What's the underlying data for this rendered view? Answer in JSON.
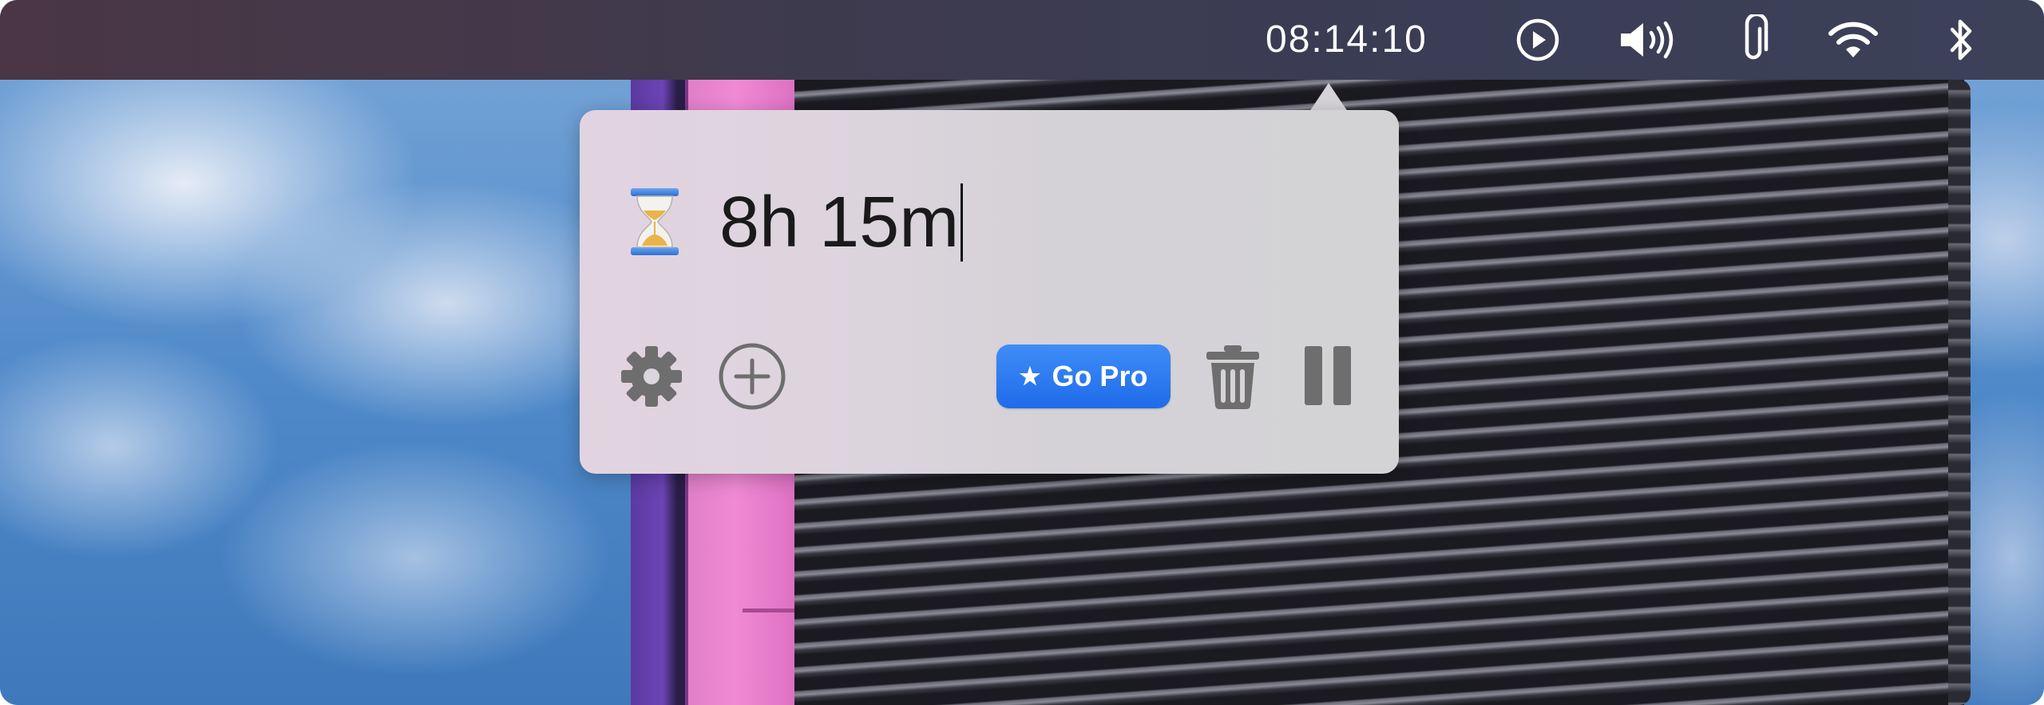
{
  "menubar": {
    "clock": "08:14:10",
    "icons": [
      "play-circle-icon",
      "volume-icon",
      "paperclip-icon",
      "wifi-icon",
      "bluetooth-icon"
    ]
  },
  "popover": {
    "timer_icon": "hourglass-icon",
    "timer_value": "8h 15m",
    "settings_icon": "gear-icon",
    "add_icon": "plus-circle-icon",
    "go_pro_star": "★",
    "go_pro_label": "Go Pro",
    "delete_icon": "trash-icon",
    "pause_icon": "pause-icon"
  },
  "colors": {
    "go_pro_button": "#2a78f0",
    "icon_gray": "#6e6e6e",
    "menubar_text": "#ffffff"
  }
}
